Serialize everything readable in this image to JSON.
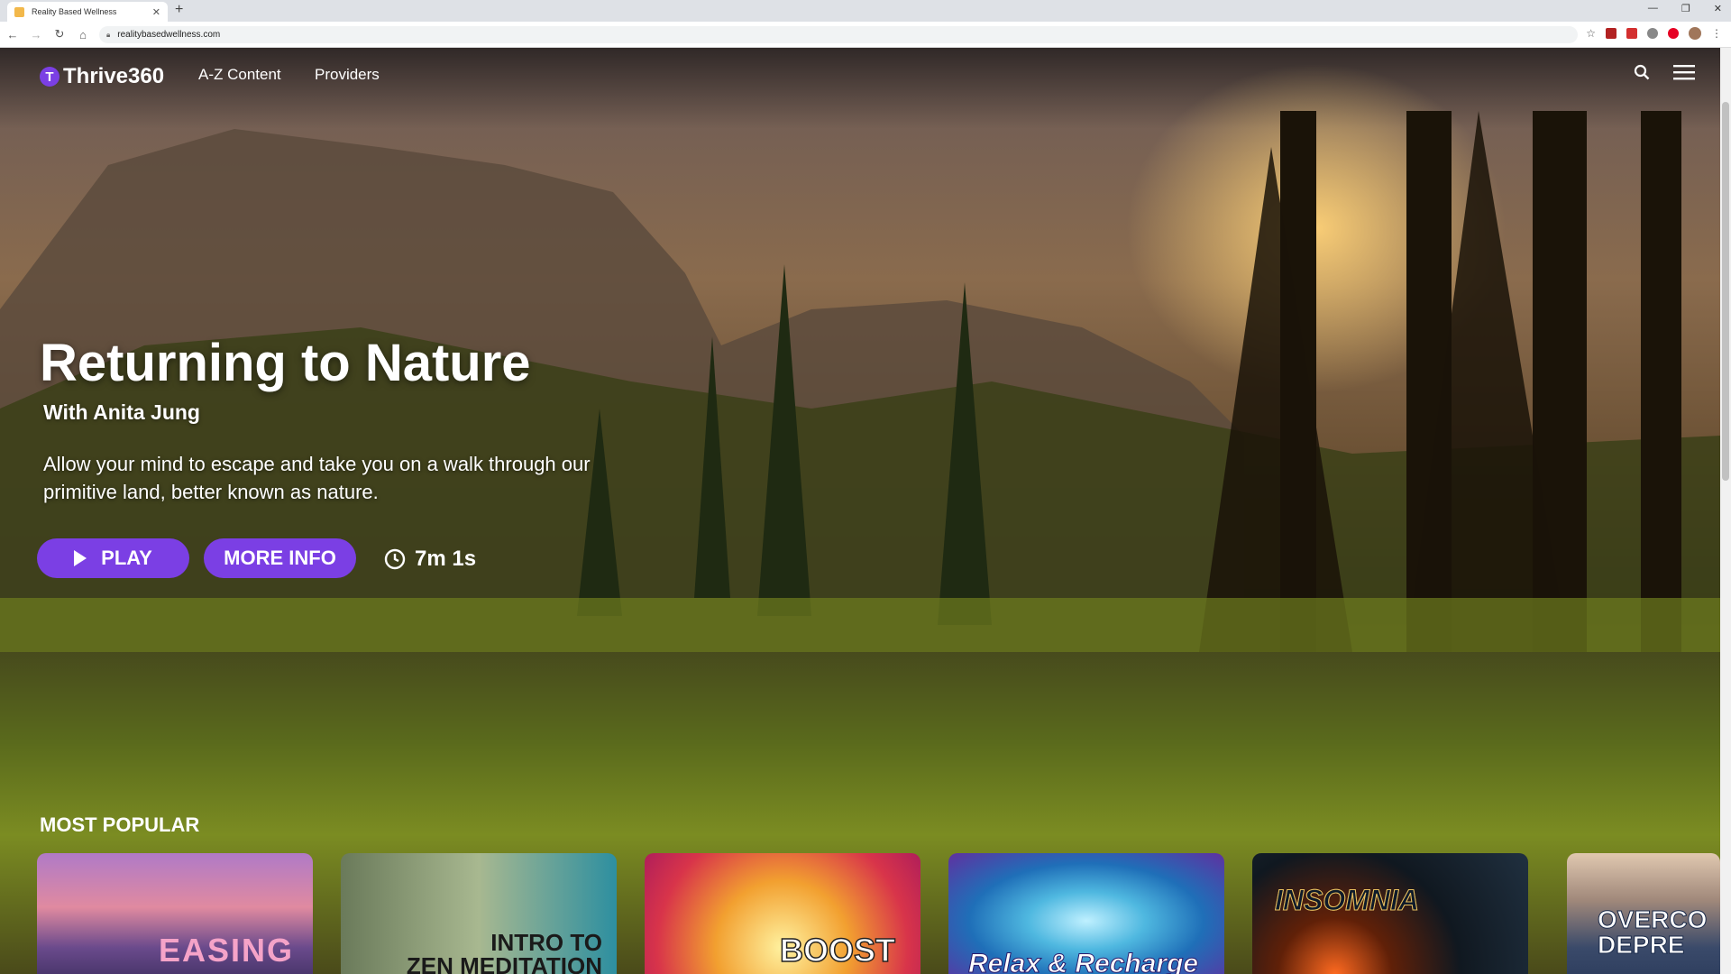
{
  "browser": {
    "tab_title": "Reality Based Wellness",
    "new_tab": "+",
    "url": "realitybasedwellness.com"
  },
  "nav": {
    "logo_text": "Thrive",
    "logo_number": "360",
    "logo_badge": "T",
    "links": [
      "A-Z Content",
      "Providers"
    ]
  },
  "hero": {
    "title": "Returning to Nature",
    "subtitle": "With Anita Jung",
    "description": "Allow your mind to escape and take you on a walk through our primitive land, better known as nature.",
    "play_label": "PLAY",
    "more_info_label": "MORE INFO",
    "duration": "7m 1s"
  },
  "most_popular": {
    "title": "MOST POPULAR",
    "cards": [
      {
        "label": "EASING"
      },
      {
        "label": "INTRO TO\nZEN MEDITATION"
      },
      {
        "label": "BOOST"
      },
      {
        "label": "Relax & Recharge"
      },
      {
        "label": "INSOMNIA"
      },
      {
        "label": "OVERCO\nDEPRE"
      }
    ]
  },
  "colors": {
    "accent": "#7b3fe4",
    "white": "#ffffff"
  }
}
